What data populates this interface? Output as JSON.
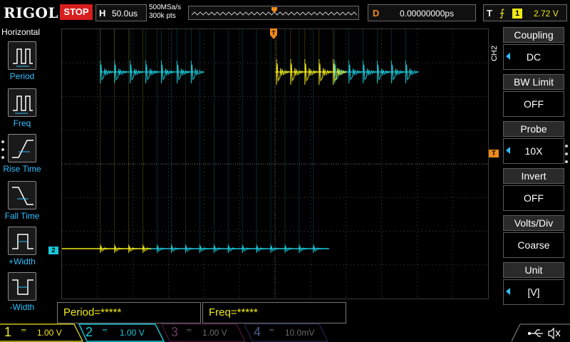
{
  "header": {
    "brand": "RIGOL",
    "run_state": "STOP",
    "timebase_letter": "H",
    "timebase": "50.0us",
    "sample_rate": "500MSa/s",
    "memory_depth": "300k pts",
    "delay_letter": "D",
    "delay": "0.00000000ps",
    "trigger_letter": "T",
    "trigger_source": "1",
    "trigger_level": "2.72 V"
  },
  "left_menu": {
    "title": "Horizontal",
    "items": [
      {
        "label": "Period",
        "icon": "period-icon"
      },
      {
        "label": "Freq",
        "icon": "freq-icon"
      },
      {
        "label": "Rise Time",
        "icon": "rise-time-icon"
      },
      {
        "label": "Fall Time",
        "icon": "fall-time-icon"
      },
      {
        "label": "+Width",
        "icon": "positive-width-icon"
      },
      {
        "label": "-Width",
        "icon": "negative-width-icon"
      }
    ]
  },
  "markers": {
    "ch2": "2",
    "trigger_level": "T"
  },
  "measurements": [
    {
      "text": "Period=*****"
    },
    {
      "text": "Freq=*****"
    }
  ],
  "right_menu": {
    "tag": "CH2",
    "items": [
      {
        "title": "Coupling",
        "value": "DC",
        "arrow": true
      },
      {
        "title": "BW Limit",
        "value": "OFF",
        "arrow": false
      },
      {
        "title": "Probe",
        "value": "10X",
        "arrow": true
      },
      {
        "title": "Invert",
        "value": "OFF",
        "arrow": false
      },
      {
        "title": "Volts/Div",
        "value": "Coarse",
        "arrow": false
      },
      {
        "title": "Unit",
        "value": "[V]",
        "arrow": true
      }
    ]
  },
  "channels": [
    {
      "num": "1",
      "scale": "1.00 V",
      "color": "#f0e81c",
      "active": true
    },
    {
      "num": "2",
      "scale": "1.00 V",
      "color": "#19c8d8",
      "active": true
    },
    {
      "num": "3",
      "scale": "1.00 V",
      "color": "#c0209a",
      "active": false
    },
    {
      "num": "4",
      "scale": "10.0mV",
      "color": "#3b5bd8",
      "active": false
    }
  ],
  "colors": {
    "ch1": "#f0e81c",
    "ch2": "#19c8d8",
    "trigger": "#f08a1c",
    "stop": "#d81e1e",
    "accent": "#2ec1ff"
  },
  "waveforms": {
    "ch2_upper_pulse_starts_us": [
      -246,
      -226,
      -204,
      -182,
      -160,
      -138,
      -118,
      84,
      104,
      124,
      144,
      164,
      184
    ],
    "ch1_upper_pulse_starts_us": [
      2,
      22,
      42,
      62,
      82
    ],
    "lower_pulse_starts_us": [
      -246,
      -226,
      -206,
      -186,
      -166,
      -146,
      -126,
      -106,
      -86,
      -66,
      -46,
      -26,
      -6,
      14,
      34,
      54
    ]
  }
}
